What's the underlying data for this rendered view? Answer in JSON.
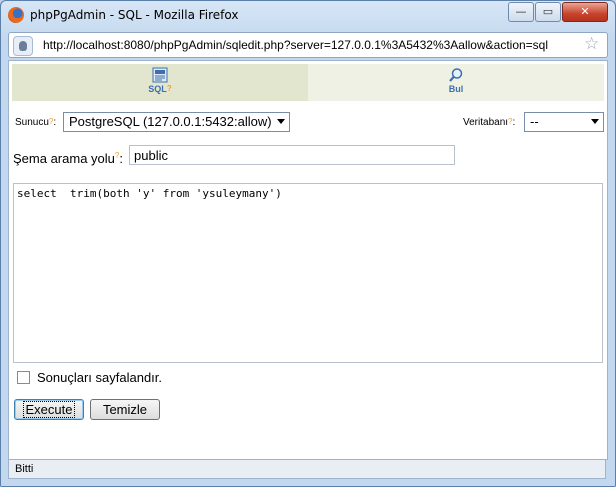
{
  "window": {
    "title": "phpPgAdmin - SQL - Mozilla Firefox",
    "min": "—",
    "max": "▭",
    "close": "✕"
  },
  "addressbar": {
    "url": "http://localhost:8080/phpPgAdmin/sqledit.php?server=127.0.0.1%3A5432%3Aallow&action=sql"
  },
  "tabs": [
    {
      "label": "SQL",
      "help": "?"
    },
    {
      "label": "Bul"
    }
  ],
  "form": {
    "server_label": "Sunucu",
    "server_help": "?",
    "server_value": "PostgreSQL (127.0.0.1:5432:allow)",
    "database_label": "Veritabanı",
    "database_help": "?",
    "database_value": "--",
    "schema_label": "Şema arama yolu",
    "schema_help": "?",
    "schema_value": "public",
    "sql": "select  trim(both 'y' from 'ysuleymany')",
    "paginate_label": "Sonuçları sayfalandır.",
    "paginate_checked": false,
    "execute_label": "Execute",
    "clear_label": "Temizle"
  },
  "status": {
    "text": "Bitti"
  }
}
